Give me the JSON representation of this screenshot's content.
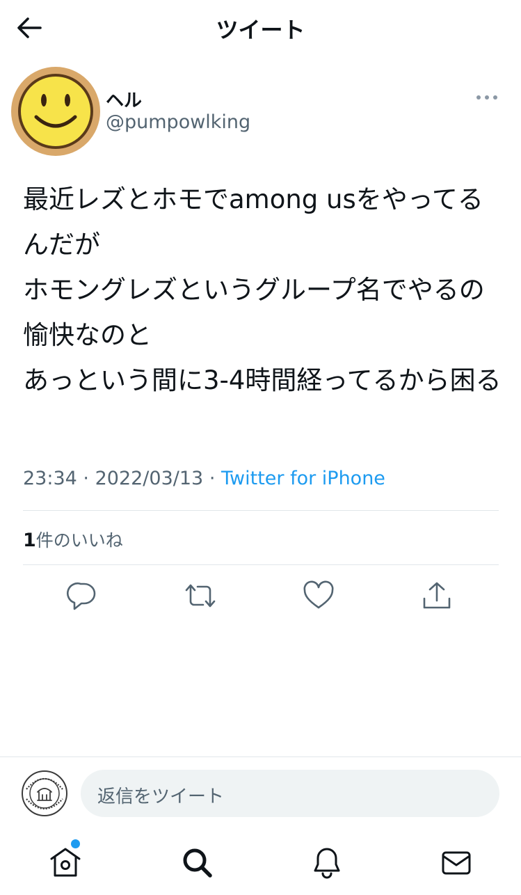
{
  "header": {
    "title": "ツイート",
    "back_icon": "arrow-left-icon"
  },
  "tweet": {
    "display_name": "ヘル",
    "handle": "@pumpowlking",
    "text": "最近レズとホモでamong usをやってるんだが\nホモングレズというグループ名でやるの愉快なのと\nあっという間に3-4時間経ってるから困る",
    "time": "23:34",
    "date": "2022/03/13",
    "separator": "·",
    "source": "Twitter for iPhone",
    "likes_count": "1",
    "likes_label": "件のいいね"
  },
  "actions": [
    "reply-icon",
    "retweet-icon",
    "like-icon",
    "share-icon"
  ],
  "compose": {
    "placeholder": "返信をツイート",
    "logo_text_top": "OFFICIAL",
    "logo_text_bottom": "LASHIKU CAFE OFF"
  },
  "tabbar": [
    "home-icon",
    "search-icon",
    "notifications-icon",
    "messages-icon"
  ],
  "colors": {
    "accent": "#1d9bf0",
    "secondary_text": "#536471",
    "divider": "#e1e6ea",
    "avatar_face": "#f7e34a",
    "avatar_bg": "#d9a86a"
  }
}
